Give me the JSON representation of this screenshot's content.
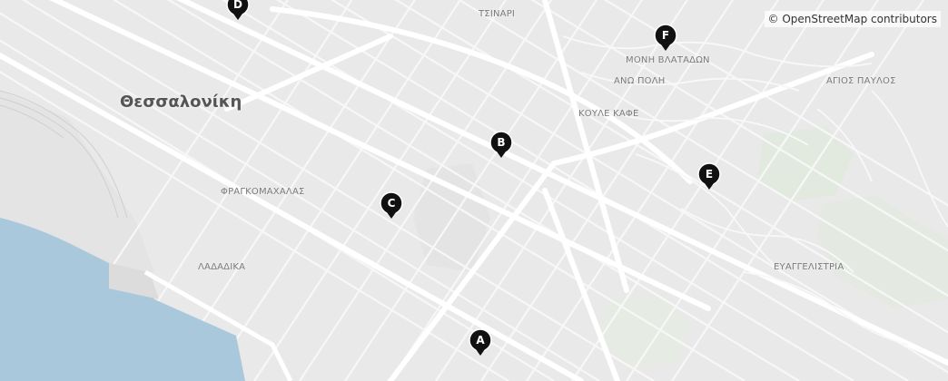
{
  "attribution": "© OpenStreetMap contributors",
  "city_label": "Θεσσαλονίκη",
  "place_labels": [
    "ΤΣΙΝΑΡΙ",
    "ΜΟΝΗ ΒΛΑΤΑΔΩΝ",
    "ΑΝΩ ΠΟΛΗ",
    "ΑΓΙΟΣ ΠΑΥΛΟΣ",
    "ΚΟΥΛΕ ΚΑΦΕ",
    "ΦΡΑΓΚΟΜΑΧΑΛΑΣ",
    "ΛΑΔΑΔΙΚΑ",
    "ΕΥΑΓΓΕΛΙΣΤΡΙΑ"
  ],
  "markers": [
    "A",
    "B",
    "C",
    "D",
    "E",
    "F"
  ],
  "colors": {
    "land": "#e9e9e9",
    "road": "#ffffff",
    "water": "#a9c8dc",
    "park": "#dde8d8",
    "marker": "#111111"
  }
}
